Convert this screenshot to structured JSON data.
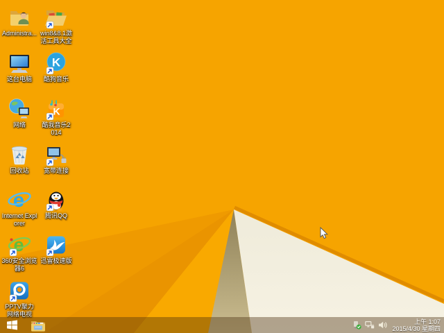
{
  "desktop": {
    "icons": [
      {
        "id": "administrator-folder",
        "label": "Administra...",
        "shortcut": false
      },
      {
        "id": "win8-activation-tools",
        "label": "win8&8.1激活工具大全",
        "shortcut": true
      },
      {
        "id": "this-pc",
        "label": "这台电脑",
        "shortcut": false
      },
      {
        "id": "kugou-music",
        "label": "酷狗音乐",
        "shortcut": true,
        "brand_color": "#2AA3DF"
      },
      {
        "id": "network",
        "label": "网络",
        "shortcut": false
      },
      {
        "id": "kuwo-music-2014",
        "label": "酷我音乐2014",
        "shortcut": true,
        "brand_color": "#FF9400"
      },
      {
        "id": "recycle-bin",
        "label": "回收站",
        "shortcut": false
      },
      {
        "id": "broadband-connection",
        "label": "宽带连接",
        "shortcut": true
      },
      {
        "id": "internet-explorer",
        "label": "Internet Explorer",
        "shortcut": false,
        "brand_color": "#2FA8E8"
      },
      {
        "id": "tencent-qq",
        "label": "腾讯QQ",
        "shortcut": true,
        "brand_color": "#E23B30"
      },
      {
        "id": "360-safe-browser",
        "label": "360安全浏览器6",
        "shortcut": true,
        "brand_color": "#5FBE3E"
      },
      {
        "id": "xunlei-speed",
        "label": "迅雷极速版",
        "shortcut": true,
        "brand_color": "#1478CC"
      },
      {
        "id": "pptv-nettv",
        "label": "PPTV聚力 网络电视",
        "shortcut": true,
        "brand_color": "#1C86D4"
      }
    ]
  },
  "taskbar": {
    "start": {
      "icon": "windows-logo"
    },
    "pinned": [
      {
        "icon": "file-explorer"
      }
    ],
    "tray": {
      "icons": [
        "safely-remove-hardware",
        "wired-network",
        "volume"
      ]
    },
    "clock": {
      "time": "上午 1:07",
      "date": "2015/4/30 星期四"
    }
  },
  "theme": {
    "wallpaper_orange": "#F6A400",
    "wallpaper_orange_dark": "#EA9400",
    "wallpaper_ridge": "#E08C00",
    "wallpaper_cream": "#F3EFDF",
    "wallpaper_tan": "#B5A77C",
    "taskbar_overlay": "rgba(72,46,12,0.40)",
    "icon_label_text": "#FFFFFF"
  }
}
